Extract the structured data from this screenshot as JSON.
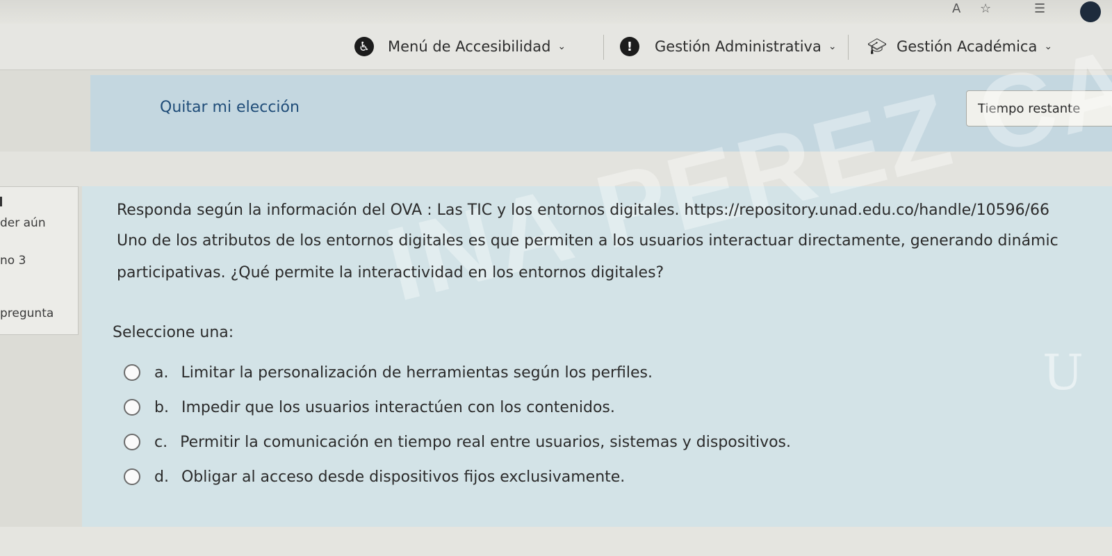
{
  "browser": {
    "icons": [
      "text-size-icon",
      "star-icon",
      "favorites-icon",
      "profile-icon"
    ],
    "text_size_glyph": "A"
  },
  "topnav": {
    "accessibility_label": "Menú de Accesibilidad",
    "admin_label": "Gestión Administrativa",
    "academic_label": "Gestión Académica"
  },
  "header": {
    "remove_choice": "Quitar mi elección",
    "time_remaining": "Tiempo restante"
  },
  "info_panel": {
    "line1": "der aún",
    "line2": "no 3",
    "line3": "pregunta"
  },
  "question": {
    "line1": "Responda según la información del OVA : Las TIC y los entornos digitales. https://repository.unad.edu.co/handle/10596/66",
    "line2": "Uno de los atributos de los entornos digitales es que permiten a los usuarios interactuar directamente, generando dinámic",
    "line3": "participativas. ¿Qué permite la interactividad en los entornos digitales?",
    "select_label": "Seleccione una:",
    "options": [
      {
        "letter": "a.",
        "text": "Limitar la personalización de herramientas según los perfiles."
      },
      {
        "letter": "b.",
        "text": "Impedir que los usuarios interactúen con los contenidos."
      },
      {
        "letter": "c.",
        "text": "Permitir la comunicación en tiempo real entre usuarios, sistemas y dispositivos."
      },
      {
        "letter": "d.",
        "text": "Obligar al acceso desde dispositivos fijos exclusivamente."
      }
    ]
  },
  "watermark": "INA PEREZ CARDOSO",
  "colors": {
    "header_band": "#c4d7e0",
    "card": "#d3e3e7",
    "link": "#1f4c78"
  }
}
